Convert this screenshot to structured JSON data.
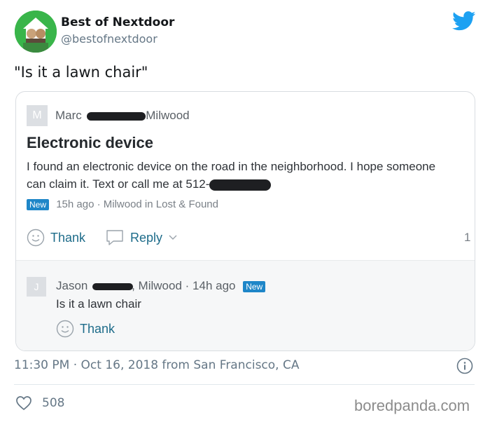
{
  "tweet": {
    "display_name": "Best of Nextdoor",
    "handle": "@bestofnextdoor",
    "text": "\"Is it a lawn chair\"",
    "timestamp": "11:30 PM · Oct 16, 2018 from San Francisco, CA",
    "likes": "508"
  },
  "post": {
    "avatar_letter": "M",
    "author_first": "Marc",
    "author_location": "Milwood",
    "title": "Electronic device",
    "body_line1": "I found an electronic device on the road in the neighborhood.  I hope someone",
    "body_line2": "can claim it.  Text or call me at 512-",
    "badge": "New",
    "meta": "15h ago · Milwood in Lost & Found",
    "thank_label": "Thank",
    "reply_label": "Reply",
    "reply_count": "1"
  },
  "reply": {
    "avatar_letter": "J",
    "author_first": "Jason",
    "author_location": ", Milwood",
    "time": " · 14h ago",
    "badge": "New",
    "text": "Is it a lawn chair",
    "thank_label": "Thank"
  },
  "watermark": "boredpanda.com",
  "colors": {
    "twitter_blue": "#1da1f2",
    "nextdoor_green": "#39b54a",
    "link_teal": "#1e6c8a",
    "badge_blue": "#1e86c8"
  }
}
